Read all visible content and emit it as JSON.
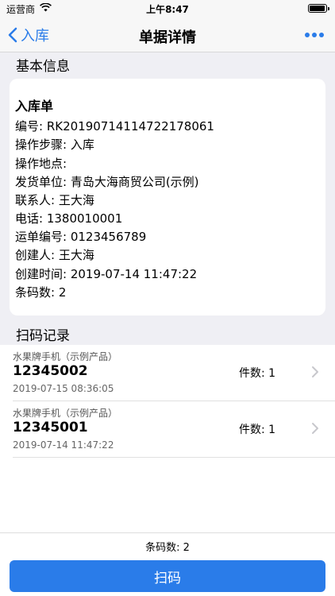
{
  "status_bar": {
    "carrier": "运营商",
    "time": "上午8:47",
    "battery_level": 0.95
  },
  "nav": {
    "back_label": "入库",
    "title": "单据详情",
    "back_icon": "chevron-left-icon",
    "more_icon": "ellipsis-icon"
  },
  "basic_info": {
    "section_title": "基本信息",
    "card_title": "入库单",
    "lines": [
      "编号: RK20190714114722178061",
      "操作步骤: 入库",
      "操作地点:",
      "发货单位: 青岛大海商贸公司(示例)",
      "联系人: 王大海",
      "电话: 1380010001",
      "运单编号: 0123456789",
      "创建人: 王大海",
      "创建时间: 2019-07-14 11:47:22",
      "条码数: 2"
    ]
  },
  "scan_records": {
    "section_title": "扫码记录",
    "items": [
      {
        "product": "水果牌手机（示例产品）",
        "code": "12345002",
        "date": "2019-07-15 08:36:05",
        "qty": "件数: 1"
      },
      {
        "product": "水果牌手机（示例产品）",
        "code": "12345001",
        "date": "2019-07-14 11:47:22",
        "qty": "件数: 1"
      }
    ]
  },
  "footer": {
    "count_label": "条码数: 2",
    "scan_button": "扫码"
  },
  "colors": {
    "accent": "#2a7ce9",
    "background": "#efeff4"
  }
}
